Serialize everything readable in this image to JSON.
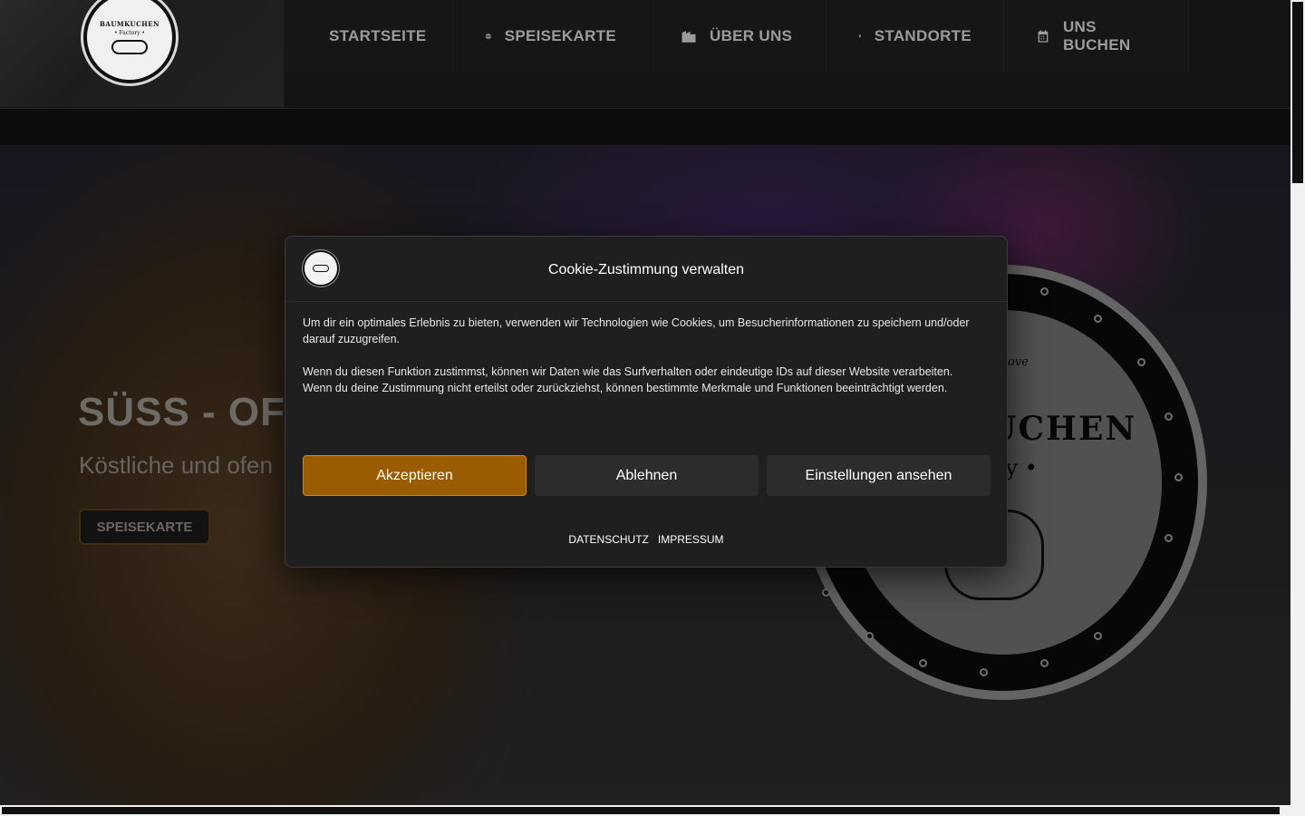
{
  "logo": {
    "line1": "BAUMKUCHEN",
    "line2": "• Factory •"
  },
  "nav": {
    "items": [
      {
        "label": "STARTSEITE",
        "icon": "home-icon"
      },
      {
        "label": "SPEISEKARTE",
        "icon": "burger-icon"
      },
      {
        "label": "ÜBER UNS",
        "icon": "building-icon"
      },
      {
        "label": "STANDORTE",
        "icon": "map-pin-icon"
      },
      {
        "label": "UNS BUCHEN",
        "icon": "calendar-icon"
      }
    ]
  },
  "hero": {
    "title": "SÜSS - OFE",
    "subtitle": "Köstliche und ofen",
    "button": "SPEISEKARTE",
    "badge_title": "UCHEN",
    "badge_sub": "ry •",
    "badge_small": "ove"
  },
  "cookie": {
    "title": "Cookie-Zustimmung verwalten",
    "paragraph1": "Um dir ein optimales Erlebnis zu bieten, verwenden wir Technologien wie Cookies, um Besucherinformationen zu speichern und/oder darauf zuzugreifen.",
    "paragraph2": "Wenn du diesen Funktion zustimmst, können wir Daten wie das Surfverhalten oder eindeutige IDs auf dieser Website verarbeiten. Wenn du deine Zustimmung nicht erteilst oder zurückziehst, können bestimmte Merkmale und Funktionen beeinträchtigt werden.",
    "accept": "Akzeptieren",
    "deny": "Ablehnen",
    "preferences": "Einstellungen ansehen",
    "link_privacy": "DATENSCHUTZ",
    "link_imprint": "IMPRESSUM"
  },
  "colors": {
    "accent": "#9b5c00",
    "modal_bg": "#1f1f1f",
    "nav_text": "#9c9c9c"
  }
}
